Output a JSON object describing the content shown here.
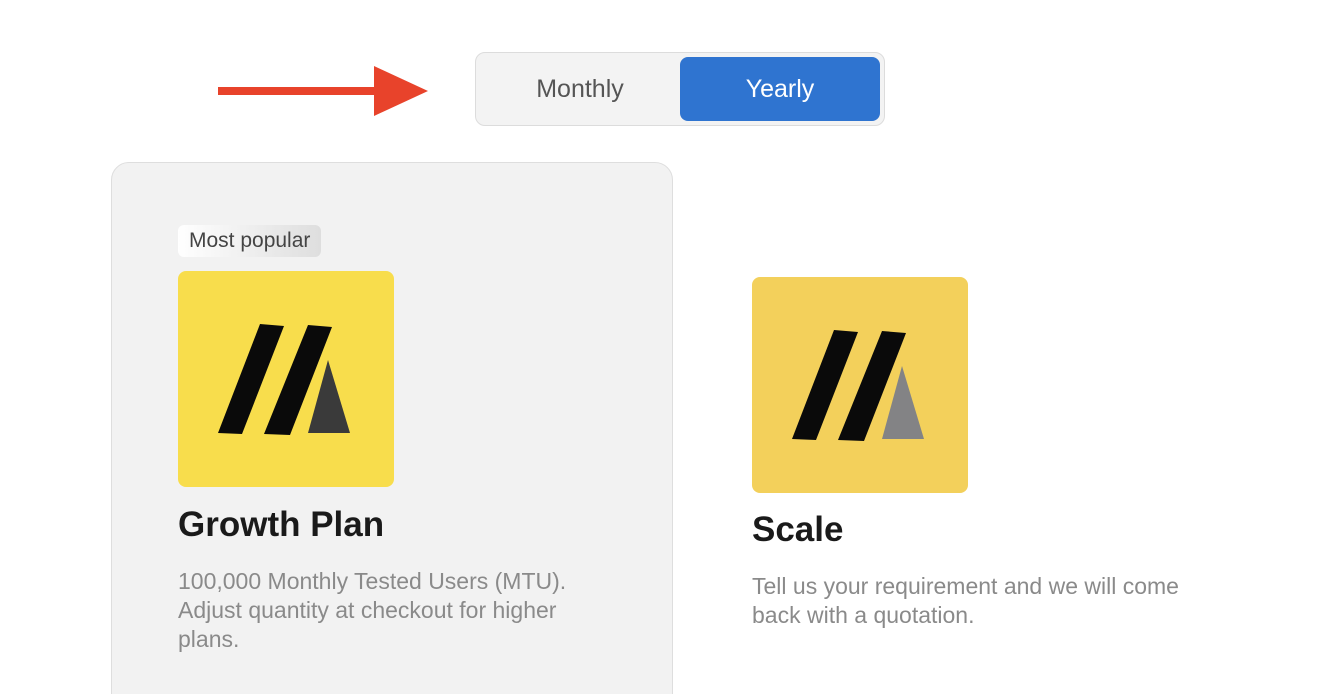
{
  "billing_toggle": {
    "monthly_label": "Monthly",
    "yearly_label": "Yearly",
    "selected": "Yearly"
  },
  "plans": [
    {
      "badge": "Most popular",
      "name": "Growth Plan",
      "description": "100,000 Monthly Tested Users (MTU). Adjust quantity at checkout for higher plans.",
      "logo_icon": "brand-logo-icon"
    },
    {
      "name": "Scale",
      "description": "Tell us your requirement and we will come back with a quotation.",
      "logo_icon": "brand-logo-icon"
    }
  ],
  "colors": {
    "accent": "#2f74d0",
    "annotation_arrow": "#e8432b",
    "growth_logo_bg": "#f8dd4c",
    "scale_logo_bg": "#f3d05b",
    "card_bg": "#f2f2f2"
  }
}
